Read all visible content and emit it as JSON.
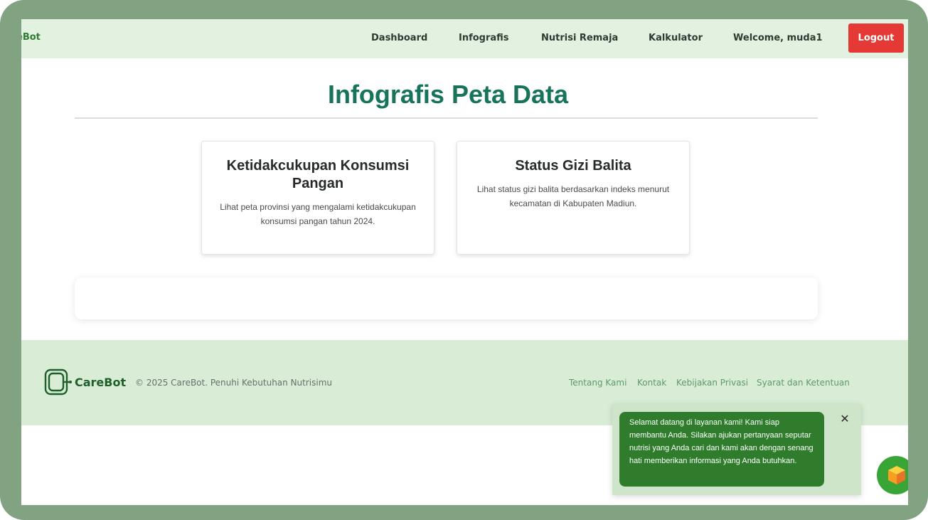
{
  "nav": {
    "brand": "eBot",
    "links": [
      "Dashboard",
      "Infografis",
      "Nutrisi Remaja",
      "Kalkulator"
    ],
    "welcome": "Welcome, muda1",
    "logout_label": "Logout"
  },
  "main": {
    "title": "Infografis Peta Data",
    "cards": [
      {
        "title": "Ketidakcukupan Konsumsi Pangan",
        "description": "Lihat peta provinsi yang mengalami ketidakcukupan konsumsi pangan tahun 2024."
      },
      {
        "title": "Status Gizi Balita",
        "description": "Lihat status gizi balita berdasarkan indeks menurut kecamatan di Kabupaten Madiun."
      }
    ]
  },
  "footer": {
    "brand": "CareBot",
    "copyright": "© 2025 CareBot. Penuhi Kebutuhan Nutrisimu",
    "links": [
      "Tentang Kami",
      "Kontak",
      "Kebijakan Privasi",
      "Syarat dan Ketentuan"
    ]
  },
  "chat": {
    "message": "Selamat datang di layanan kami! Kami siap membantu Anda. Silakan ajukan pertanyaan seputar nutrisi yang Anda cari dan kami akan dengan senang hati memberikan informasi yang Anda butuhkan.",
    "close_icon": "close-icon",
    "fab_icon": "cube-icon"
  },
  "colors": {
    "nav_bg": "#e3f1e1",
    "accent": "#17745a",
    "logout": "#e53935",
    "footer_bg": "#d8ecd6",
    "chat_bubble": "#2f7d2c",
    "fab": "#3aa537"
  }
}
